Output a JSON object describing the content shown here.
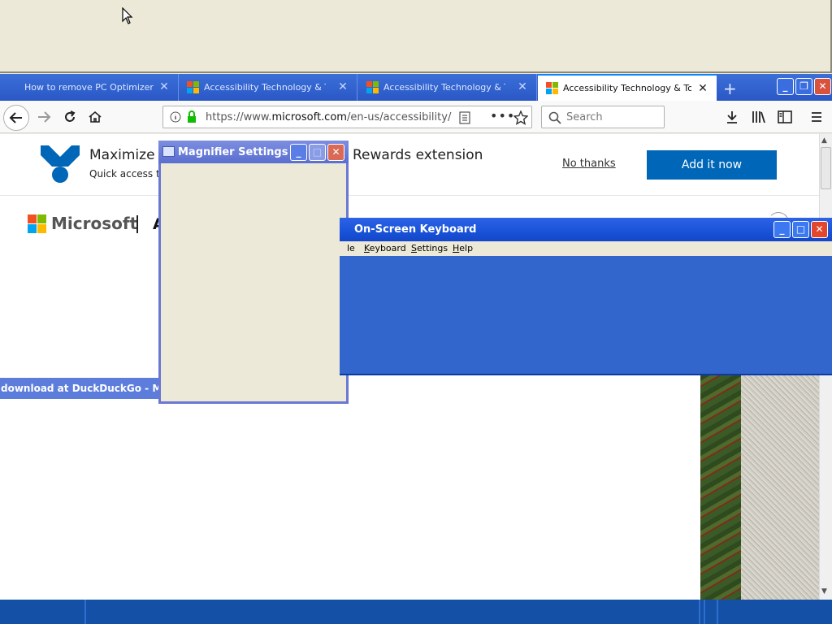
{
  "browser": {
    "tabs": [
      {
        "title": "How to remove PC Optimizer PRO",
        "close": "✕"
      },
      {
        "title": "Accessibility Technology & Tools",
        "close": "✕"
      },
      {
        "title": "Accessibility Technology & Tools",
        "close": "✕"
      },
      {
        "title": "Accessibility Technology & Tools",
        "close": "✕"
      }
    ],
    "new_tab": "+",
    "url_prefix": "https://www.",
    "url_domain": "microsoft.com",
    "url_path": "/en-us/accessibility/",
    "search_placeholder": "Search"
  },
  "page": {
    "banner_title_part1": "Maximize y",
    "banner_title_part2": "Rewards extension",
    "banner_subtitle": "Quick access to",
    "no_thanks": "No thanks",
    "add_it_now": "Add it now",
    "brand": "Microsoft",
    "header_letter": "A",
    "overlay_text": "download at DuckDuckGo - Mypa"
  },
  "magnifier": {
    "title": "Magnifier Settings"
  },
  "osk": {
    "title": "On-Screen Keyboard",
    "menu": [
      {
        "label": "le",
        "accel": ""
      },
      {
        "label": "Keyboard",
        "accel": "K"
      },
      {
        "label": "Settings",
        "accel": "S"
      },
      {
        "label": "Help",
        "accel": "H"
      }
    ]
  },
  "colors": {
    "ms_red": "#f25022",
    "ms_green": "#7fba00",
    "ms_blue": "#00a4ef",
    "ms_yellow": "#ffb900",
    "accent_blue": "#0067b8"
  }
}
